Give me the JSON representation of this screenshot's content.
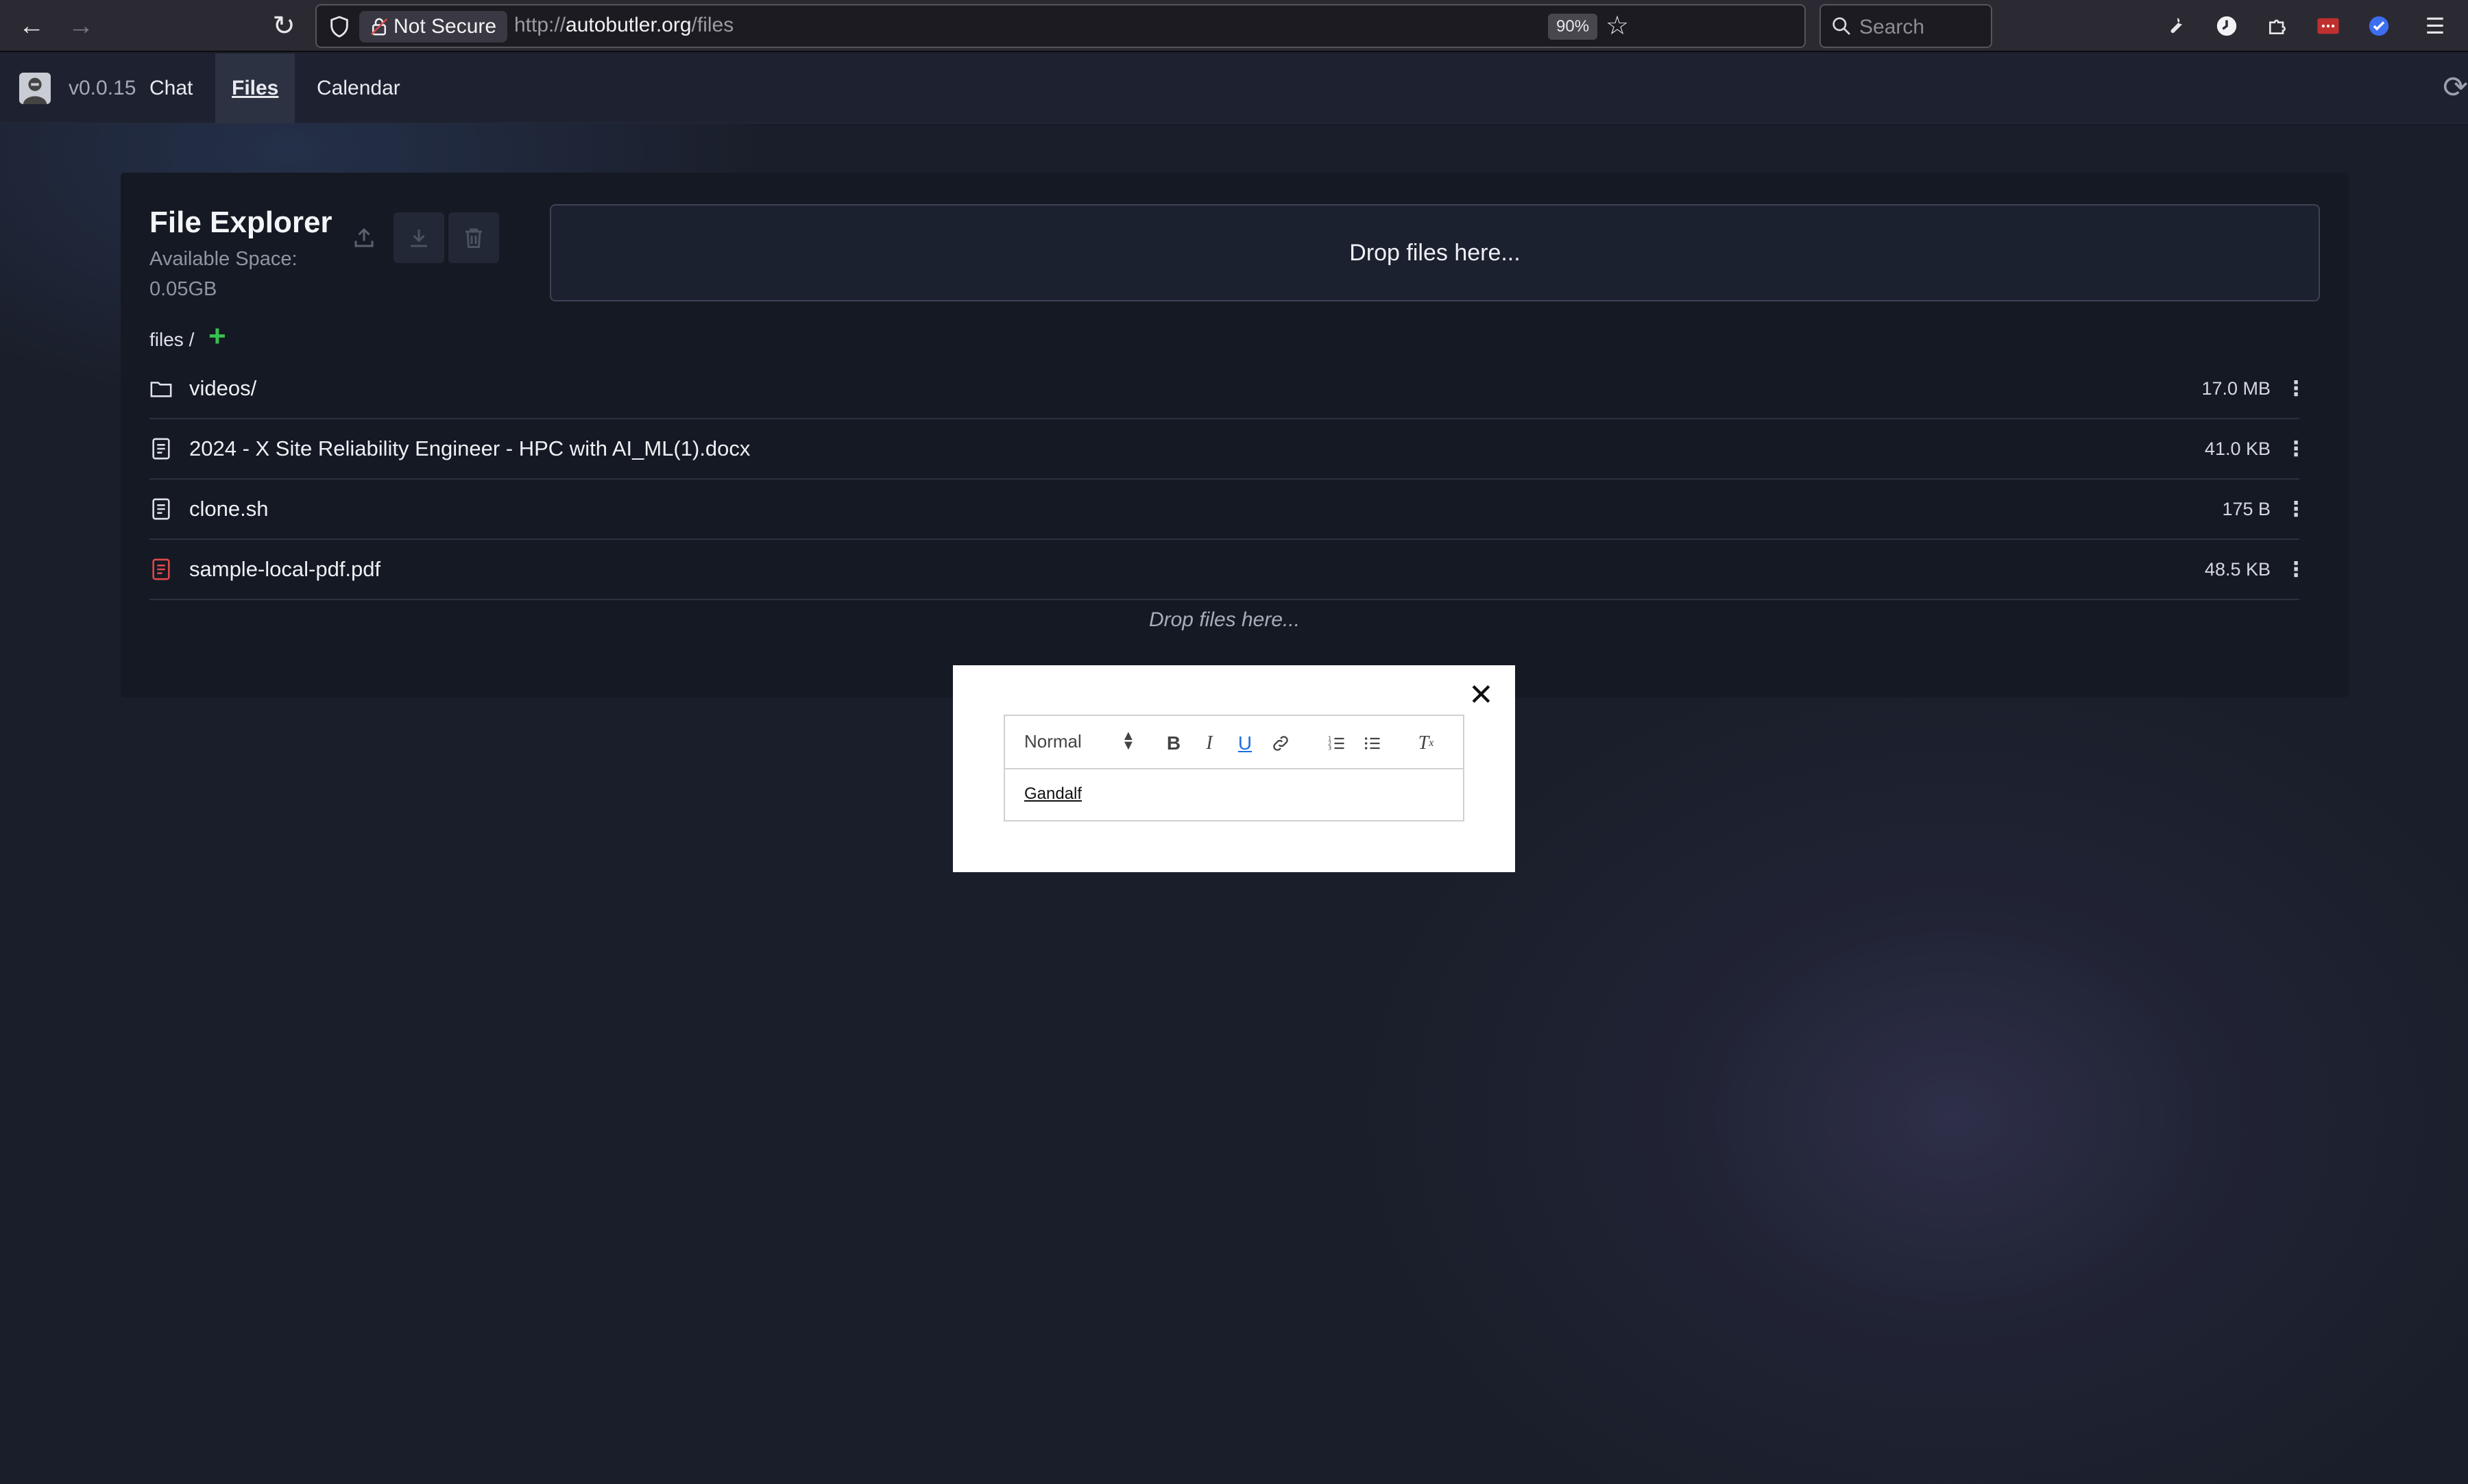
{
  "browser": {
    "security_label": "Not Secure",
    "url_prefix": "http://",
    "url_host": "autobutler.org",
    "url_path": "/files",
    "zoom": "90%",
    "search_placeholder": "Search"
  },
  "app": {
    "version": "v0.0.15",
    "nav": [
      {
        "label": "Chat",
        "active": false
      },
      {
        "label": "Files",
        "active": true
      },
      {
        "label": "Calendar",
        "active": false
      }
    ]
  },
  "explorer": {
    "title": "File Explorer",
    "available_space": "Available Space: 0.05GB",
    "dropzone_label": "Drop files here...",
    "breadcrumb": "files /",
    "files": [
      {
        "name": "videos/",
        "size": "17.0 MB",
        "type": "folder-icon"
      },
      {
        "name": "2024 - X Site Reliability Engineer - HPC with AI_ML(1).docx",
        "size": "41.0 KB",
        "type": "document-icon"
      },
      {
        "name": "clone.sh",
        "size": "175 B",
        "type": "document-icon"
      },
      {
        "name": "sample-local-pdf.pdf",
        "size": "48.5 KB",
        "type": "pdf-icon"
      }
    ],
    "list_drop_note": "Drop files here..."
  },
  "modal": {
    "format_select": "Normal",
    "editor_content": "Gandalf"
  },
  "colors": {
    "accent_green": "#35c24e",
    "pdf_red": "#e04a4a",
    "underline_blue": "#1d6fe0"
  }
}
